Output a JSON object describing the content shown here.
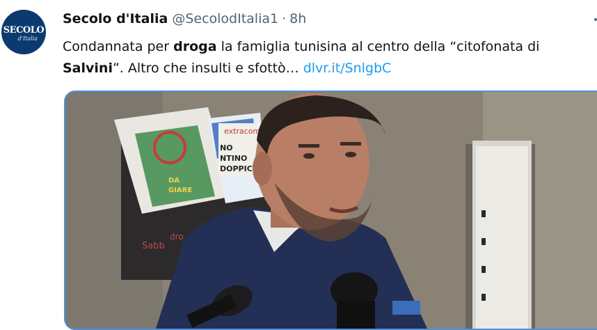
{
  "author": {
    "display_name": "Secolo d'Italia",
    "handle": "@SecolodItalia1",
    "separator": "·",
    "time": "8h",
    "avatar_text": "SECOLO",
    "avatar_subtext": "d'Italia"
  },
  "tweet": {
    "line1_part1": "Condannata per ",
    "line1_bold": "droga",
    "line1_part2": " la famiglia tunisina al centro della “citofonata di",
    "line2_bold": "Salvini",
    "line2_part1": "”. Altro che insulti e sfottò… ",
    "link_text": "dlvr.it/SnlgbC"
  },
  "media": {
    "type": "video-thumbnail",
    "poster_texts": [
      "extracom",
      "NO",
      "NTINO",
      "DOPPIC",
      "DA",
      "GIARE",
      "Sabb",
      "dro"
    ]
  },
  "colors": {
    "link": "#1d9bf0",
    "secondary_text": "#536471",
    "media_border": "#4a90e2"
  },
  "icons": {
    "more": "more-icon"
  }
}
